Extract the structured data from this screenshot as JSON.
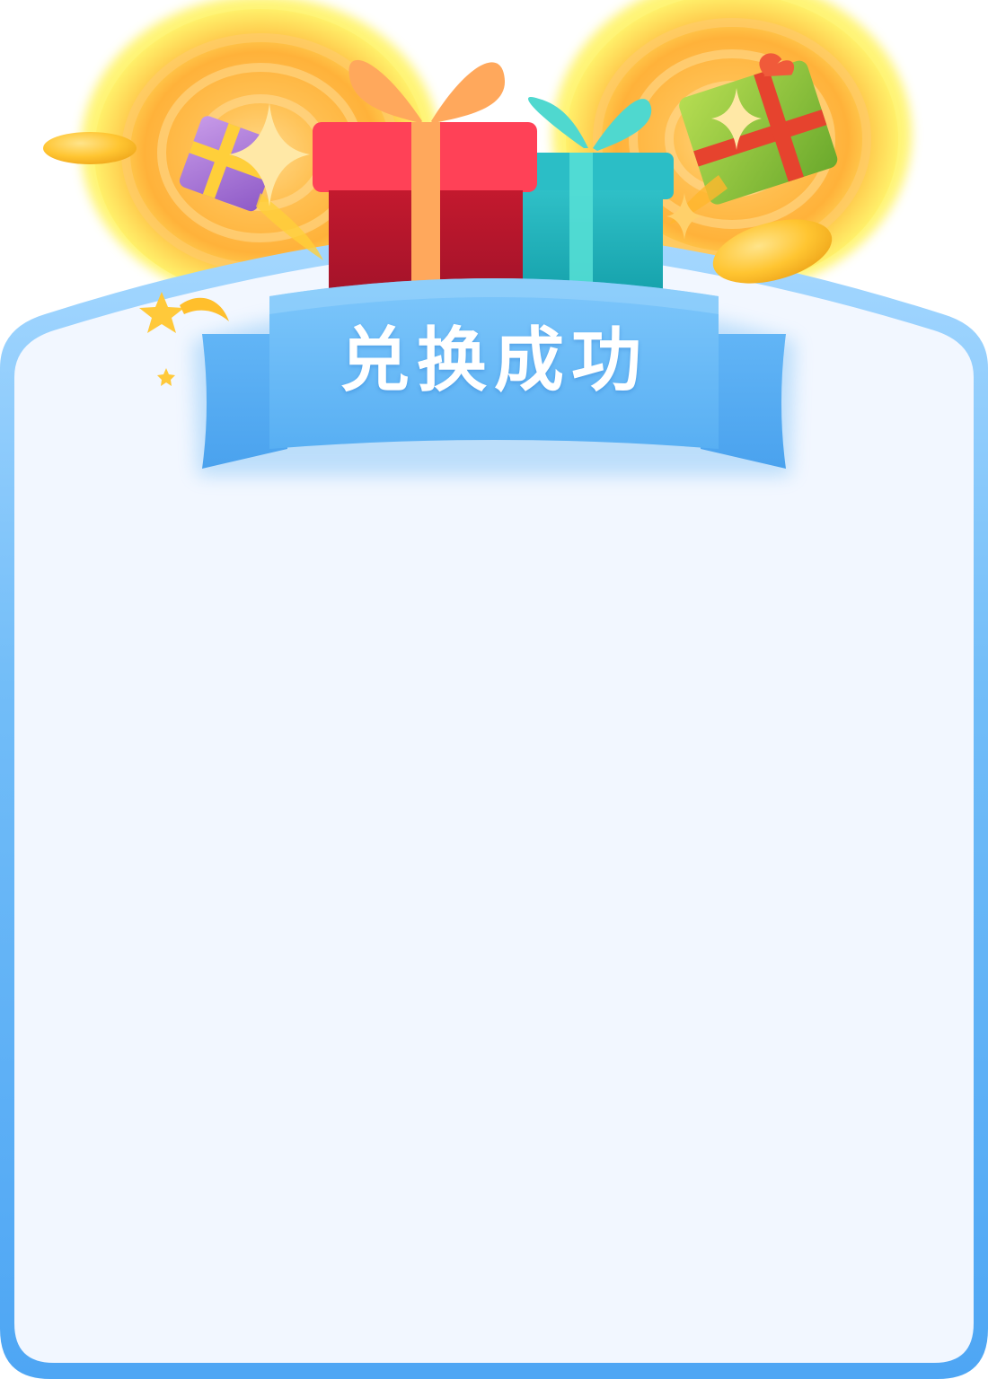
{
  "dialog": {
    "title": "兑换成功"
  },
  "colors": {
    "card_fill": "#f2f7ff",
    "card_border": "#6ab8f7",
    "ribbon": "#5db3f5",
    "ribbon_light": "#8fcdfb",
    "glow": "#ffb63b",
    "gift_red": "#d4263e",
    "gift_teal": "#23b9c2",
    "gift_green": "#8cc63f",
    "gift_purple": "#a678d6",
    "coin": "#ffc93a"
  },
  "icons": {
    "red_gift": "gift-icon",
    "teal_gift": "gift-icon",
    "green_gift": "gift-icon",
    "purple_gift": "gift-icon",
    "coins": "coin-icon",
    "sparkles": "sparkle-icon",
    "stars": "star-icon"
  }
}
